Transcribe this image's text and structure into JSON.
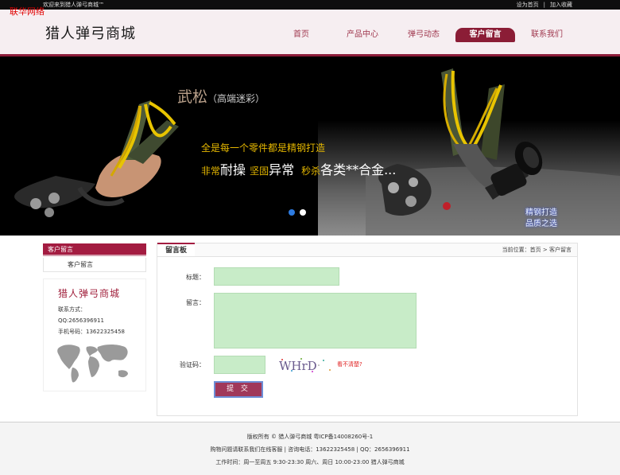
{
  "topbar": {
    "welcome": "欢迎来到猎人弹弓商城™",
    "links": [
      "设为首页",
      "加入收藏"
    ]
  },
  "watermark": "联华网络",
  "header": {
    "logo": "猎人弹弓商城",
    "nav": [
      {
        "label": "首页",
        "active": false
      },
      {
        "label": "产品中心",
        "active": false
      },
      {
        "label": "弹弓动态",
        "active": false
      },
      {
        "label": "客户留言",
        "active": true
      },
      {
        "label": "联系我们",
        "active": false
      }
    ]
  },
  "banner": {
    "title": "武松",
    "subtitle": "（高端迷彩）",
    "line1": "全是每一个零件都是精钢打造",
    "line2": [
      "非常",
      "耐操",
      "坚固",
      "异常",
      "秒杀",
      "各类**合金..."
    ],
    "badge": [
      "精钢打造",
      "品质之选"
    ],
    "slides": 2,
    "active_slide": 0
  },
  "sidebar": {
    "heading": "客户留言",
    "items": [
      "客户留言"
    ],
    "contact": {
      "title": "猎人弹弓商城",
      "label": "联系方式：",
      "qq": "QQ:2656396911",
      "phone": "手机号码：13622325458"
    }
  },
  "main": {
    "tab": "留言板",
    "breadcrumb": "当前位置：首页 > 客户留言",
    "form": {
      "title_label": "标题：",
      "title_value": "",
      "message_label": "留言：",
      "message_value": "",
      "captcha_label": "验证码：",
      "captcha_value": "",
      "captcha_text": "WHrD",
      "captcha_link": "看不清楚?",
      "submit": "提 交"
    }
  },
  "footer": {
    "lines": [
      "版权所有 © 猎人弹弓商城 粤ICP备14008260号-1",
      "购物问题请联系我们在线客服 | 咨询电话：13622325458 | QQ：2656396911",
      "工作时间：周一至周五 9:30-23:30 周六、周日 10:00-23:00 猎人弹弓商城"
    ]
  },
  "colors": {
    "brand": "#8b1d36",
    "nav_text": "#a0384f",
    "field_bg": "#c8ecc8",
    "banner_accent": "#e5b700"
  }
}
